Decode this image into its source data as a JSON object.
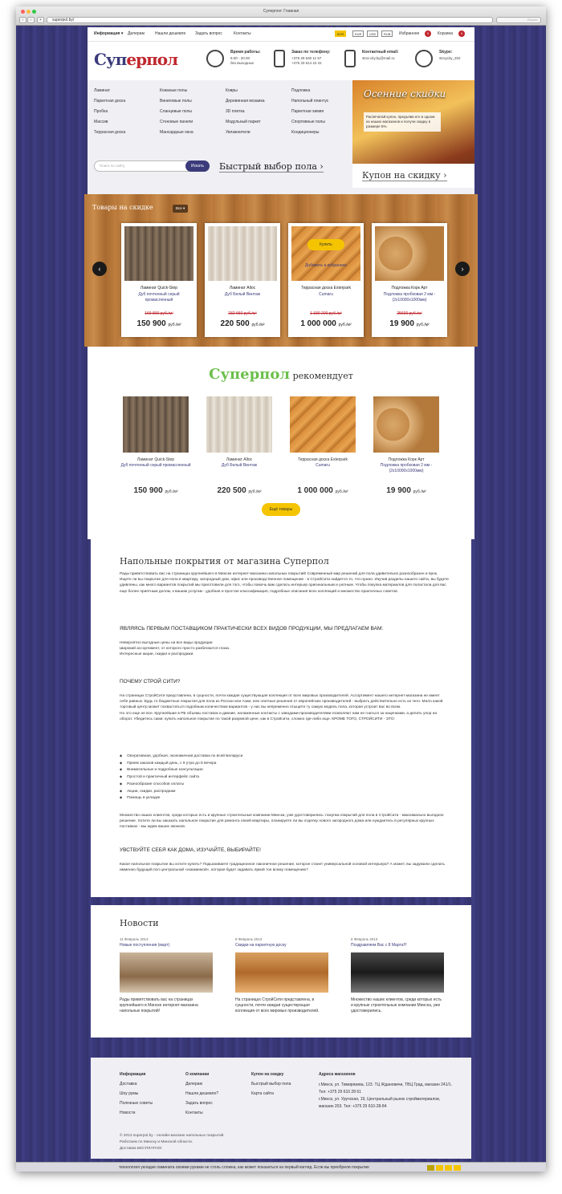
{
  "browser": {
    "title": "Суперпол: Главная",
    "url": "superpol.by/",
    "reader": "Reader"
  },
  "topnav": [
    "Информация ▾",
    "Дилерам",
    "Нашли дешевле",
    "Задать вопрос",
    "Контакты"
  ],
  "currencies": [
    "BYR",
    "EUR",
    "USD",
    "RUB"
  ],
  "wishlist": {
    "label": "Избранное",
    "count": "0"
  },
  "cart": {
    "label": "Корзина",
    "count": "0"
  },
  "logo": "Суперпол",
  "contacts": [
    {
      "title": "Время работы:",
      "lines": "9.00 - 20.00\nбез выходных"
    },
    {
      "title": "Заказ по телефону:",
      "lines": "+375 29 630 11 57\n+375 33 614 22 22"
    },
    {
      "title": "Контактный email:",
      "lines": "stroi-city.by@mail.ru"
    },
    {
      "title": "Skype:",
      "lines": "stroycity_202"
    }
  ],
  "categories": [
    [
      "Ламинат",
      "Паркетная доска",
      "Пробка",
      "Массив",
      "Террасная доска"
    ],
    [
      "Кожаные полы",
      "Виниловые полы",
      "Сланцевые полы",
      "Стеновые панели",
      "Мансардные окна"
    ],
    [
      "Ковры",
      "Деревянная мозаика",
      "3D плитка",
      "Модульный паркет",
      "Увлажнители"
    ],
    [
      "Подложка",
      "Напольный плинтус",
      "Паркетная химия",
      "Спортивные полы",
      "Кондиционеры"
    ]
  ],
  "search": {
    "placeholder": "Поиск по сайту",
    "button": "Искать"
  },
  "quick_select": "Быстрый выбор пола ›",
  "promo": {
    "title": "Осенние скидки",
    "text": "Распечатай купон, предъяви его в одном из наших магазинов и получи скидку в размере 5%.",
    "coupon": "Купон на скидку ›"
  },
  "sale": {
    "title": "Товары на скидке",
    "filter": "Все ▾",
    "buy": "Купить",
    "fav": "Добавить в избранное",
    "unit": "руб./м²",
    "items": [
      {
        "name": "Ламинат Quick-Step",
        "collection": "Дуб почтенный серый промасленный",
        "old": "169 800 руб./м²",
        "price": "150 900"
      },
      {
        "name": "Ламинат Alloc",
        "collection": "Дуб Белый Винтаж",
        "old": "232 650 руб./м²",
        "price": "220 500"
      },
      {
        "name": "Террасная доска Exterpark",
        "collection": "Cumaru",
        "old": "1 330 200 руб./м²",
        "price": "1 000 000"
      },
      {
        "name": "Подложка Корк Арт",
        "collection": "Подложка пробковая 2 мм - (2х10000х1000мм)",
        "old": "25600 руб./м²",
        "price": "19 900"
      }
    ]
  },
  "recommend": {
    "brand": "Суперпол",
    "word": "рекомендует",
    "more": "Ещё товары",
    "unit": "руб./м²",
    "items": [
      {
        "name": "Ламинат Quick-Step",
        "collection": "Дуб почтенный серый промасленный",
        "price": "150 900"
      },
      {
        "name": "Ламинат Alloc",
        "collection": "Дуб Белый Винтаж",
        "price": "220 500"
      },
      {
        "name": "Террасная доска Exterpark",
        "collection": "Cumaru",
        "price": "1 000 000"
      },
      {
        "name": "Подложка Корк Арт",
        "collection": "Подложка пробковая 2 мм - (2х10000х1000мм)",
        "price": "19 900"
      }
    ]
  },
  "article": {
    "title": "Напольные покрытия от магазина Суперпол",
    "p1": "Рады приветствовать вас на страницах крупнейшего в Минске интернет-магазина напольных покрытий! Современный мир решений для пола удивительно разнообразен и ярок. Ищете ли вы покрытие для пола в квартиру, загородный дом, офис или производственное помещение - в СтройСити найдется то, что нужно. Изучив разделы нашего сайта, вы будете удивлены, как много вариантов покрытий мы приготовили для того, чтобы помочь вам сделать интерьер оригинальным и уютным. Чтобы покупка материалов для поластала для вас еще более приятным делом, к вашим услугам - удобная и простая классификация, подробные описания всех коллекций и множество практичных советов.",
    "h2": "ЯВЛЯЯСЬ ПЕРВЫМ ПОСТАВЩИКОМ ПРАКТИЧЕСКИ ВСЕХ ВИДОВ ПРОДУКЦИИ, МЫ ПРЕДЛАГАЕМ ВАМ:",
    "p2": "Невероятно выгодные цены на все виды продукции\nШирокий ассортимент, от которого просто разбегаются глаза.\nИнтересные акции, скидки и распродажи.",
    "h3": "ПОЧЕМУ СТРОЙ СИТИ?",
    "p3": "На страницах СтройСити представлена, в сущности, почти каждая существующая коллекция от всех мировых производителей. Ассортимент нашего интернет-магазина не имеет себе равных. Будь то бюджетные покрытия для пола из России или Азии, или элитные решения от европейских производителей - выбрать действительно есть из чего. Мало какой торговый центр может похвастаться подобным количеством вариантов - у нас вы непременно отыщете ту самую модель пола, которая устроит вас во всем.\nНо это еще не все. Крупнейшие в РБ объемы поставок и давние, налаженные контакты с заводами-производителями позволяют нам не гнаться за наценками, а делать упор на оборот. Убедитесь сами: купить напольное покрытие по такой разумной цене, как в Стройсити, сложно где-либо еще. КРОМЕ ТОГО, СТРОЙСИТИ - ЭТО:",
    "list": [
      "Оперативная, удобная, экономичная доставка по всей Беларуси",
      "Прием заказов каждый день, с 9 утра до 8 вечера",
      "Внимательные и подробные консультации",
      "Простой и практичный интерфейс сайта",
      "Разнообразие способов оплаты",
      "Акции, скидки, распродажи",
      "Помощь в укладке"
    ],
    "p4": "Множество наших клиентов, среди которых есть и крупные строительные компании Минска, уже удостоверились: покупка покрытий для пола в СтройСити - максимально выгодное решение. Хотите ли вы заказать напольное покрытие для ремонта своей квартиры, планируете ли вы отделку нового загородного дома или нуждаетесь в регулярных крупных поставках - мы ждем ваших звонков.",
    "h4": "УВСТВУЙТЕ СЕБЯ КАК ДОМА, ИЗУЧАЙТЕ, ВЫБИРАЙТЕ!",
    "p5": "Какое напольное покрытие вы хотите купить? Подыскиваете традиционное лаконичное решение, которое станет универсальной основой интерьера? А может, вы задумали сделать имменно будущий пол центральной «изюминкой», которая будет задавать яркий тон всему помещению?"
  },
  "news": {
    "title": "Новости",
    "items": [
      {
        "date": "11 Февраль 2013",
        "title": "Новые поступления (март)",
        "text": "Рады приветствовать вас на страницах крупнейшего в Минске интернет-магазина напольных покрытий!"
      },
      {
        "date": "8 Февраль 2013",
        "title": "Скидки на паркетную доску",
        "text": "На страницах СтройСити представлена, в сущности, почти каждая существующая коллекция от всех мировых производителей."
      },
      {
        "date": "6 Февраль 2013",
        "title": "Поздравляем Вас с 8 Марта!!!",
        "text": "Множество наших клиентов, среди которых есть и крупные строительные компании Минска, уже удостоверились."
      }
    ]
  },
  "footer": {
    "cols": [
      {
        "title": "Информация",
        "links": [
          "Доставка",
          "Шоу румы",
          "Полезные советы",
          "Новости"
        ]
      },
      {
        "title": "О компании",
        "links": [
          "Дилерам",
          "Нашли дешевле?",
          "Задать вопрос",
          "Контакты"
        ]
      },
      {
        "title": "Купон на скидку",
        "links": [
          "Быстрый выбор пола",
          "Карта сайта"
        ]
      }
    ],
    "shops_title": "Адреса магазинов",
    "shops": "г.Минск, ул. Тимирязева, 123. ТЦ Ждановичи, ТВЦ Град, магазин 241/1. Тел: +375 29 610 28 61\nг.Минск, ул. Уручская, 19, Центральный рынок стройматериалов, магазин 203. Тел: +375 29 610-28-84",
    "copy": "© 2013 superpol.by - онлайн-магазин напольных покрытий.\nРаботаем по Минску и Минской области.\nДоставка БЕСПЛАТНО!"
  },
  "ticker": "технология укладки ламината своими руками не столь сложна, как может показаться на первый взгляд. Если вы приобрели покрытие"
}
